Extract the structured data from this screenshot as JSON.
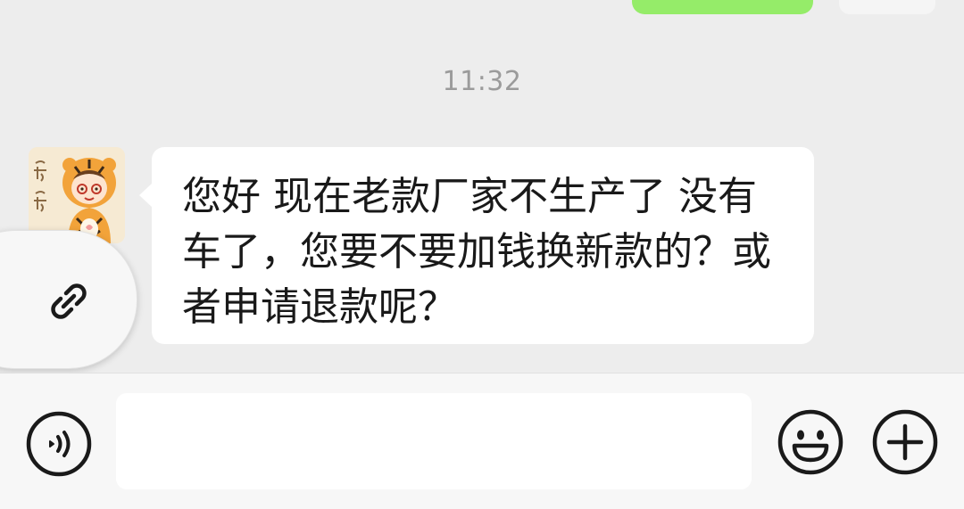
{
  "chat": {
    "timestamp": "11:32",
    "messages": [
      {
        "sender": "other",
        "avatar_icon": "tiger-costume-avatar",
        "text": "您好 现在老款厂家不生产了 没有车了，您要不要加钱换新款的？或者申请退款呢？"
      }
    ]
  },
  "overlay": {
    "icon": "link-icon"
  },
  "input_bar": {
    "voice_icon": "voice-icon",
    "input_value": "",
    "emoji_icon": "emoji-icon",
    "plus_icon": "plus-icon"
  },
  "colors": {
    "background": "#ededed",
    "sent_bubble": "#95ec69",
    "received_bubble": "#ffffff",
    "timestamp_text": "#9b9b9b",
    "message_text": "#191919"
  }
}
